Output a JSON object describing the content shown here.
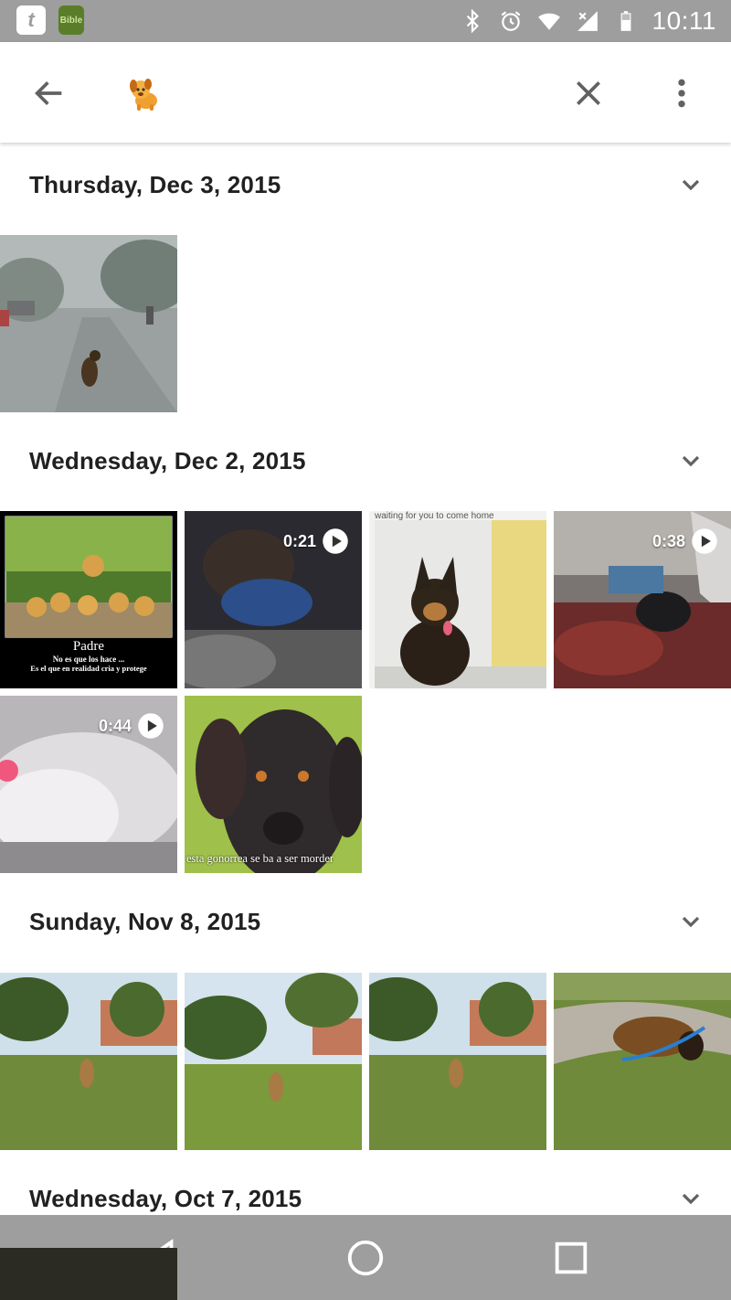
{
  "status_bar": {
    "time": "10:11",
    "apps": [
      {
        "label": "t",
        "icon": "tumblr-app-icon"
      },
      {
        "label": "Bible",
        "icon": "bible-app-icon"
      }
    ],
    "icons": [
      "bluetooth-icon",
      "alarm-icon",
      "wifi-icon",
      "signal-icon",
      "battery-icon"
    ]
  },
  "toolbar": {
    "back_icon": "arrow-left-icon",
    "search_chip": "dog-emoji-chip",
    "clear_icon": "close-icon",
    "menu_icon": "more-vert-icon"
  },
  "sections": [
    {
      "date": "Thursday, Dec 3, 2015",
      "items": [
        {
          "kind": "photo",
          "desc": "dog on rainy road"
        }
      ]
    },
    {
      "date": "Wednesday, Dec 2, 2015",
      "items": [
        {
          "kind": "photo",
          "caption_lines": [
            "Padre",
            "No es que los hace ...",
            "Es el que en realidad cria y protege"
          ]
        },
        {
          "kind": "video",
          "duration": "0:21"
        },
        {
          "kind": "photo",
          "top_text": "waiting for you to come home"
        },
        {
          "kind": "video",
          "duration": "0:38"
        },
        {
          "kind": "video",
          "duration": "0:44"
        },
        {
          "kind": "photo",
          "bottom_text": "esta gonorrea se ba a ser morder"
        }
      ]
    },
    {
      "date": "Sunday, Nov 8, 2015",
      "items": [
        {
          "kind": "photo"
        },
        {
          "kind": "photo"
        },
        {
          "kind": "photo"
        },
        {
          "kind": "photo"
        }
      ]
    },
    {
      "date": "Wednesday, Oct 7, 2015",
      "items": []
    }
  ],
  "nav_bar": {
    "buttons": [
      "back-nav-icon",
      "home-nav-icon",
      "recents-nav-icon"
    ]
  },
  "colors": {
    "status_bar": "#9e9e9e",
    "nav_bar": "#9e9e9e",
    "text": "#212121",
    "icon": "#616161"
  }
}
